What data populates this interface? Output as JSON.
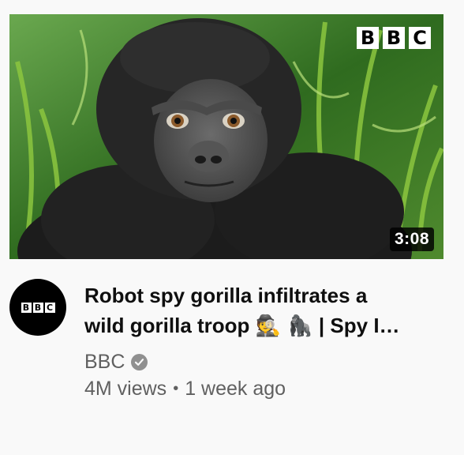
{
  "thumbnail": {
    "brand_letters": [
      "B",
      "B",
      "C"
    ],
    "duration": "3:08"
  },
  "channel": {
    "avatar_letters": [
      "B",
      "B",
      "C"
    ],
    "name": "BBC",
    "verified_icon": "check-circle-icon"
  },
  "video": {
    "title_line1": "Robot spy gorilla infiltrates a",
    "title_line2_text": "wild gorilla troop ",
    "title_emoji": "🕵 🦍",
    "title_line2_suffix": " | Spy I…",
    "views": "4M views",
    "separator": "•",
    "age": "1 week ago"
  },
  "colors": {
    "background": "#f9f9f9",
    "title": "#0f0f0f",
    "secondary_text": "#606060"
  }
}
